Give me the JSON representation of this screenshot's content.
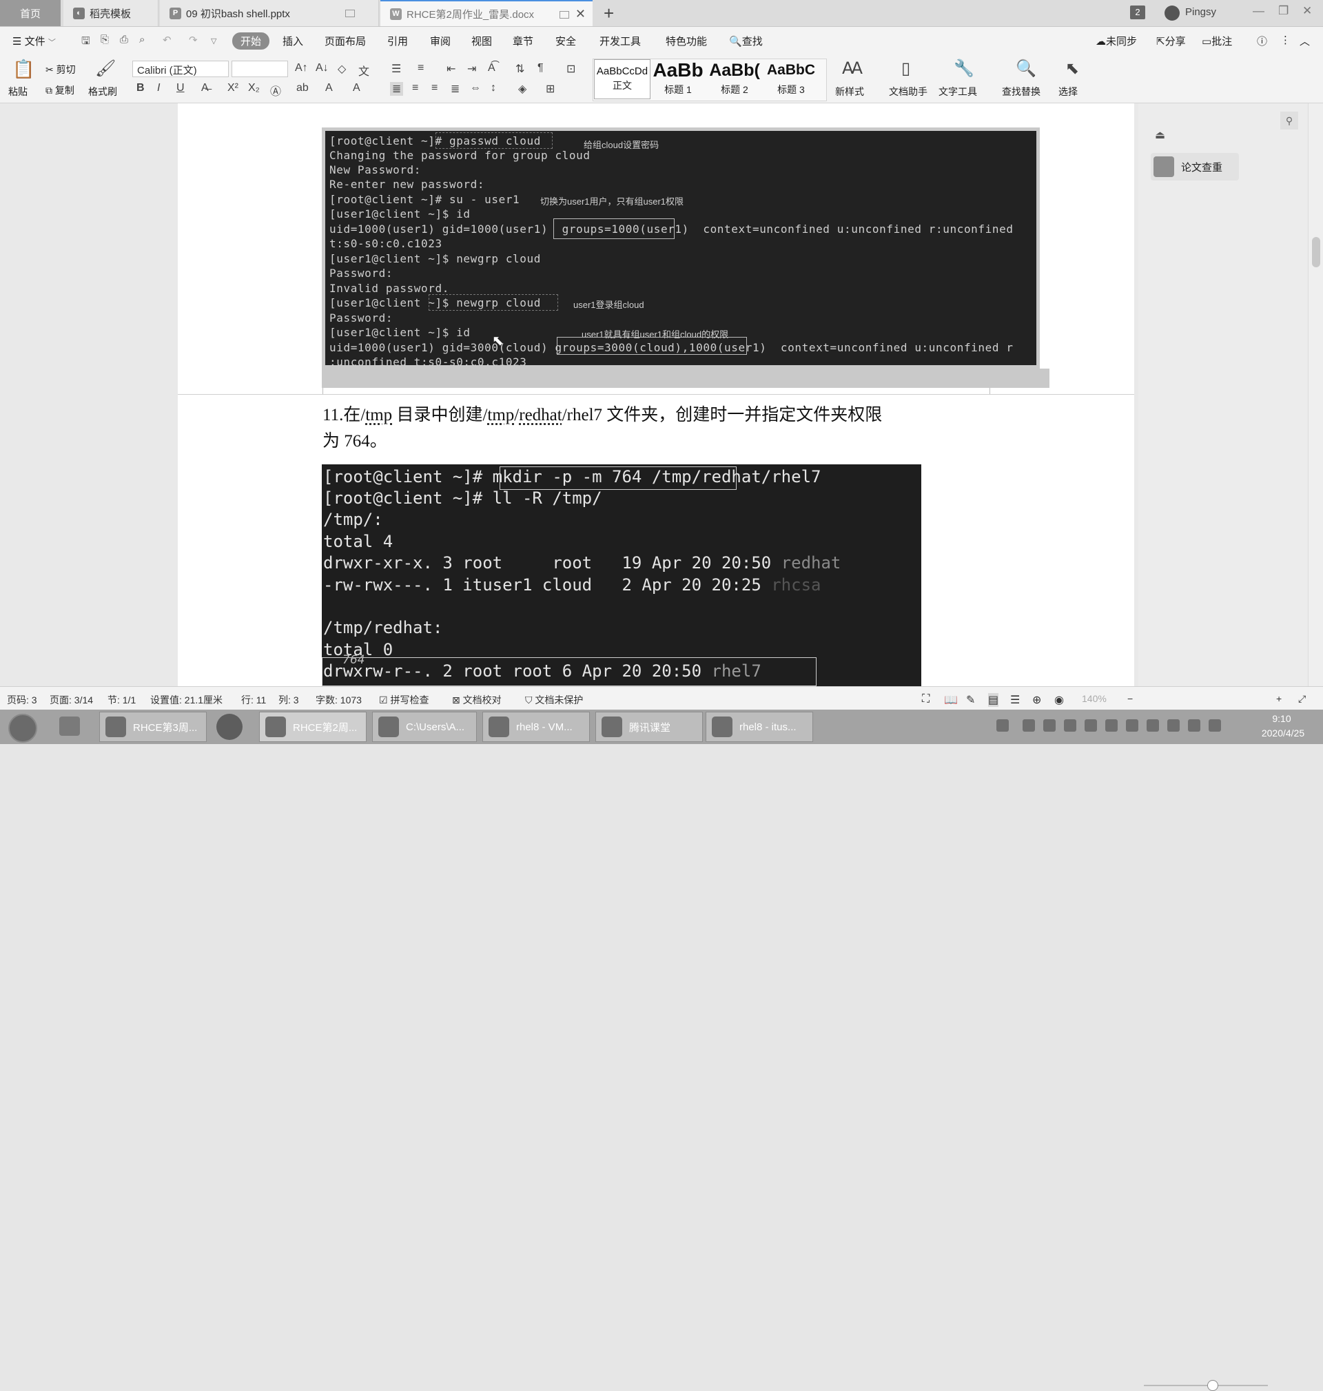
{
  "tabs": {
    "home": "首页",
    "t1": "稻壳模板",
    "t2": "09 初识bash shell.pptx",
    "t3": "RHCE第2周作业_雷昊.docx",
    "add": "+",
    "badge": "2",
    "user": "Pingsy"
  },
  "menu": {
    "file": "文件",
    "items": [
      "开始",
      "插入",
      "页面布局",
      "引用",
      "审阅",
      "视图",
      "章节",
      "安全",
      "开发工具",
      "特色功能"
    ],
    "search": "查找",
    "right": [
      "未同步",
      "分享",
      "批注"
    ]
  },
  "ribbon": {
    "paste": "粘贴",
    "cut": "剪切",
    "copy": "复制",
    "format_painter": "格式刷",
    "font_name": "Calibri (正文)",
    "styles": [
      {
        "sample": "AaBbCcDd",
        "label": "正文"
      },
      {
        "sample": "AaBb",
        "label": "标题 1"
      },
      {
        "sample": "AaBb(",
        "label": "标题 2"
      },
      {
        "sample": "AaBbC",
        "label": "标题 3"
      }
    ],
    "new_style": "新样式",
    "doc_assistant": "文档助手",
    "text_tools": "文字工具",
    "find_replace": "查找替换",
    "select": "选择"
  },
  "terminal1": {
    "lines": [
      "[root@client ~]# gpasswd cloud",
      "Changing the password for group cloud",
      "New Password:",
      "Re-enter new password:",
      "[root@client ~]# su - user1",
      "[user1@client ~]$ id",
      "uid=1000(user1) gid=1000(user1)  groups=1000(user1)  context=unconfined u:unconfined r:unconfined",
      "t:s0-s0:c0.c1023",
      "[user1@client ~]$ newgrp cloud",
      "Password:",
      "Invalid password.",
      "[user1@client ~]$ newgrp cloud",
      "Password:",
      "[user1@client ~]$ id",
      "uid=1000(user1) gid=3000(cloud) groups=3000(cloud),1000(user1)  context=unconfined u:unconfined r",
      ":unconfined t:s0-s0:c0.c1023"
    ],
    "annotations": [
      "给组cloud设置密码",
      "切换为user1用户，只有组user1权限",
      "user1登录组cloud",
      "user1就具有组user1和组cloud的权限"
    ]
  },
  "heading": {
    "line1_a": "11.在/",
    "line1_tmp1": "tmp",
    "line1_b": " 目录中创建/",
    "line1_tmp2": "tmp",
    "line1_c": "/",
    "line1_redhat": "redhat",
    "line1_d": "/rhel7 文件夹，创建时一并指定文件夹权限",
    "line2": "为 764。"
  },
  "terminal2": {
    "lines": [
      "[root@client ~]# mkdir -p -m 764 /tmp/redhat/rhel7",
      "[root@client ~]# ll -R /tmp/",
      "/tmp/:",
      "total 4",
      "drwxr-xr-x. 3 root     root   19 Apr 20 20:50 ",
      "-rw-rwx---. 1 ituser1 cloud   2 Apr 20 20:25 ",
      "",
      "/tmp/redhat:",
      "total 0",
      "drwxrw-r--. 2 root root 6 Apr 20 20:50 "
    ],
    "dim_names": [
      "redhat",
      "rhcsa",
      "rhel7"
    ],
    "handwriting": "764"
  },
  "rightpane": {
    "paper_check": "论文查重"
  },
  "status": {
    "items": [
      "页码: 3",
      "页面: 3/14",
      "节: 1/1",
      "设置值: 21.1厘米",
      "行: 11",
      "列: 3",
      "字数: 1073"
    ],
    "spell": "拼写检查",
    "proof": "文档校对",
    "protect": "文档未保护",
    "zoom": "140%"
  },
  "taskbar": {
    "apps": [
      "RHCE第3周...",
      "RHCE第2周...",
      "C:\\Users\\A...",
      "rhel8 - VM...",
      "腾讯课堂",
      "rhel8 - itus..."
    ],
    "time": "9:10",
    "date": "2020/4/25"
  }
}
